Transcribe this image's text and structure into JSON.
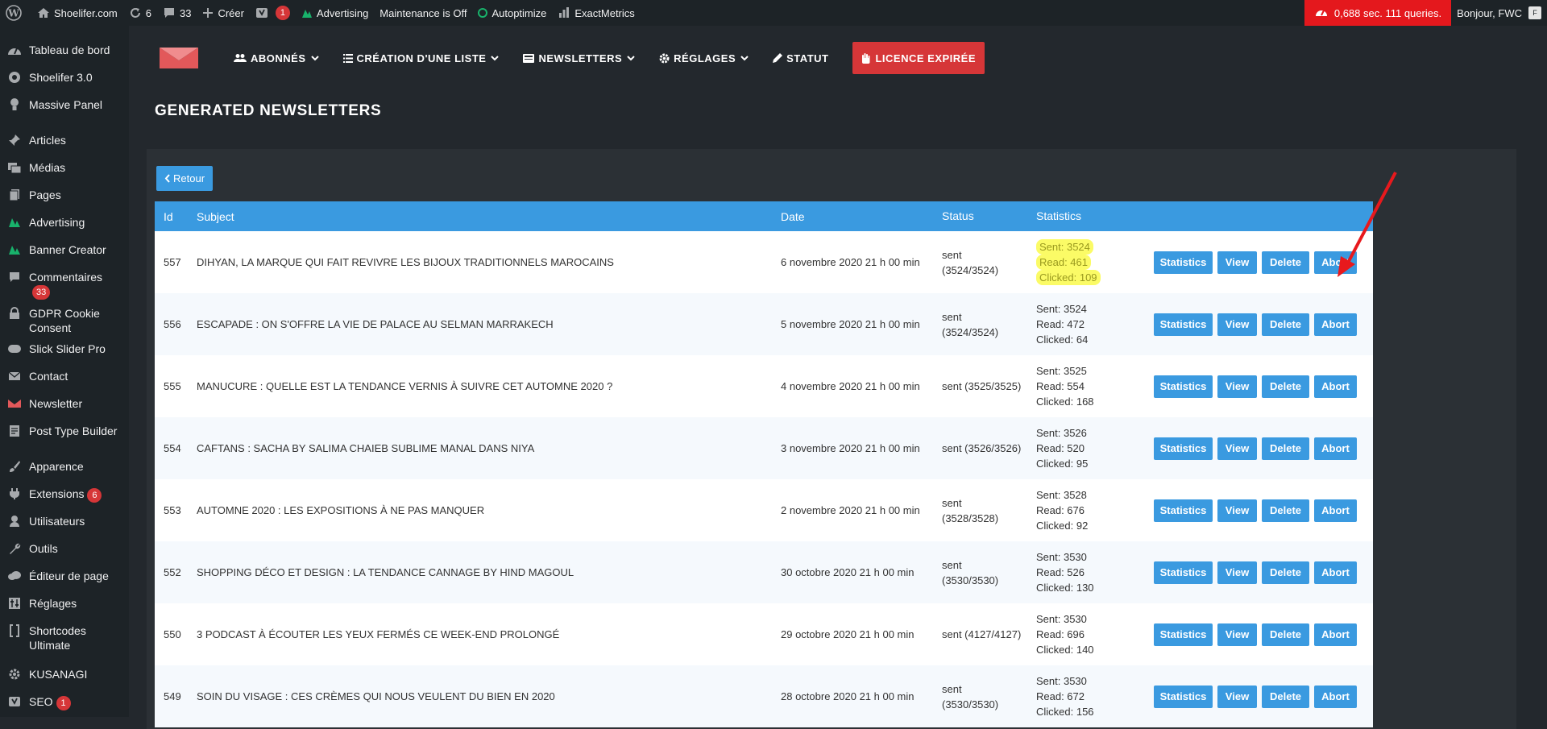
{
  "adminbar": {
    "site_name": "Shoelifer.com",
    "updates_count": "6",
    "comments_count": "33",
    "create_label": "Créer",
    "yoast_count": "1",
    "advertising_label": "Advertising",
    "maintenance_label": "Maintenance is Off",
    "autoptimize_label": "Autoptimize",
    "exactmetrics_label": "ExactMetrics",
    "perf_label": "0,688 sec. 111 queries.",
    "greeting": "Bonjour, FWC",
    "avatar_letter": "F"
  },
  "sidebar": {
    "items": [
      {
        "label": "Tableau de bord"
      },
      {
        "label": "Shoelifer 3.0"
      },
      {
        "label": "Massive Panel"
      },
      {
        "label": "Articles"
      },
      {
        "label": "Médias"
      },
      {
        "label": "Pages"
      },
      {
        "label": "Advertising"
      },
      {
        "label": "Banner Creator"
      },
      {
        "label": "Commentaires",
        "badge": "33"
      },
      {
        "label": "GDPR Cookie Consent"
      },
      {
        "label": "Slick Slider Pro"
      },
      {
        "label": "Contact"
      },
      {
        "label": "Newsletter"
      },
      {
        "label": "Post Type Builder"
      },
      {
        "label": "Apparence"
      },
      {
        "label": "Extensions",
        "badge": "6"
      },
      {
        "label": "Utilisateurs"
      },
      {
        "label": "Outils"
      },
      {
        "label": "Éditeur de page"
      },
      {
        "label": "Réglages"
      },
      {
        "label": "Shortcodes Ultimate"
      },
      {
        "label": "KUSANAGI"
      },
      {
        "label": "SEO",
        "badge": "1"
      }
    ]
  },
  "plugin_nav": {
    "abonnes": "ABONNÉS",
    "creation": "CRÉATION D'UNE LISTE",
    "newsletters": "NEWSLETTERS",
    "reglages": "RÉGLAGES",
    "statut": "STATUT",
    "licence": "LICENCE EXPIRÉE"
  },
  "page": {
    "title": "GENERATED NEWSLETTERS",
    "retour_label": "Retour"
  },
  "table": {
    "headers": {
      "id": "Id",
      "subject": "Subject",
      "date": "Date",
      "status": "Status",
      "statistics": "Statistics"
    },
    "actions": {
      "statistics": "Statistics",
      "view": "View",
      "delete": "Delete",
      "abort": "Abort"
    },
    "rows": [
      {
        "id": "557",
        "subject": "DIHYAN, LA MARQUE QUI FAIT REVIVRE LES BIJOUX TRADITIONNELS MAROCAINS",
        "date": "6 novembre 2020 21 h 00 min",
        "status_line1": "sent",
        "status_line2": "(3524/3524)",
        "sent": "Sent: 3524",
        "read": "Read: 461",
        "clicked": "Clicked: 109",
        "highlight": true
      },
      {
        "id": "556",
        "subject": "ESCAPADE : ON S'OFFRE LA VIE DE PALACE AU SELMAN MARRAKECH",
        "date": "5 novembre 2020 21 h 00 min",
        "status_line1": "sent",
        "status_line2": "(3524/3524)",
        "sent": "Sent: 3524",
        "read": "Read: 472",
        "clicked": "Clicked: 64",
        "highlight": false
      },
      {
        "id": "555",
        "subject": "MANUCURE : QUELLE EST LA TENDANCE VERNIS À SUIVRE CET AUTOMNE 2020 ?",
        "date": "4 novembre 2020 21 h 00 min",
        "status_line1": "sent (3525/3525)",
        "status_line2": "",
        "sent": "Sent: 3525",
        "read": "Read: 554",
        "clicked": "Clicked: 168",
        "highlight": false
      },
      {
        "id": "554",
        "subject": "CAFTANS : SACHA BY SALIMA CHAIEB SUBLIME MANAL DANS NIYA",
        "date": "3 novembre 2020 21 h 00 min",
        "status_line1": "sent (3526/3526)",
        "status_line2": "",
        "sent": "Sent: 3526",
        "read": "Read: 520",
        "clicked": "Clicked: 95",
        "highlight": false
      },
      {
        "id": "553",
        "subject": "AUTOMNE 2020 : LES EXPOSITIONS À NE PAS MANQUER",
        "date": "2 novembre 2020 21 h 00 min",
        "status_line1": "sent",
        "status_line2": "(3528/3528)",
        "sent": "Sent: 3528",
        "read": "Read: 676",
        "clicked": "Clicked: 92",
        "highlight": false
      },
      {
        "id": "552",
        "subject": "SHOPPING DÉCO ET DESIGN : LA TENDANCE CANNAGE BY HIND MAGOUL",
        "date": "30 octobre 2020 21 h 00 min",
        "status_line1": "sent",
        "status_line2": "(3530/3530)",
        "sent": "Sent: 3530",
        "read": "Read: 526",
        "clicked": "Clicked: 130",
        "highlight": false
      },
      {
        "id": "550",
        "subject": "3 PODCAST À ÉCOUTER LES YEUX FERMÉS CE WEEK-END PROLONGÉ",
        "date": "29 octobre 2020 21 h 00 min",
        "status_line1": "sent (4127/4127)",
        "status_line2": "",
        "sent": "Sent: 3530",
        "read": "Read: 696",
        "clicked": "Clicked: 140",
        "highlight": false
      },
      {
        "id": "549",
        "subject": "SOIN DU VISAGE : CES CRÈMES QUI NOUS VEULENT DU BIEN EN 2020",
        "date": "28 octobre 2020 21 h 00 min",
        "status_line1": "sent",
        "status_line2": "(3530/3530)",
        "sent": "Sent: 3530",
        "read": "Read: 672",
        "clicked": "Clicked: 156",
        "highlight": false
      }
    ]
  },
  "colors": {
    "accent": "#3a9ae0",
    "danger": "#d63638",
    "perf": "#e4181d",
    "arrow": "#e8191d"
  }
}
